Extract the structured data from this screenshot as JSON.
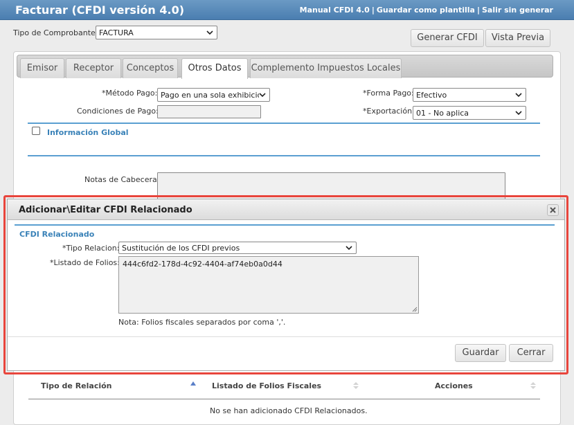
{
  "header": {
    "title": "Facturar (CFDI versión 4.0)",
    "links": [
      "Manual CFDI 4.0",
      "Guardar como plantilla",
      "Salir sin generar"
    ],
    "separator": "|"
  },
  "top": {
    "tipo_label": "Tipo de Comprobante:",
    "tipo_value": "FACTURA",
    "generar_label": "Generar CFDI",
    "vista_label": "Vista Previa"
  },
  "tabs": [
    {
      "label": "Emisor"
    },
    {
      "label": "Receptor"
    },
    {
      "label": "Conceptos"
    },
    {
      "label": "Otros Datos"
    },
    {
      "label": "Complemento Impuestos Locales"
    }
  ],
  "otros": {
    "metodo_label": "*Método Pago:",
    "metodo_value": "Pago en una sola exhibició",
    "condiciones_label": "Condiciones de Pago:",
    "forma_label": "*Forma Pago:",
    "forma_value": "Efectivo",
    "exportacion_label": "*Exportación:",
    "exportacion_value": "01 - No aplica",
    "info_global": "Información Global",
    "notas_label": "Notas de Cabecera:"
  },
  "table": {
    "headers": [
      "Tipo de Relación",
      "Listado de Folios Fiscales",
      "Acciones"
    ],
    "empty": "No se han adicionado CFDI Relacionados."
  },
  "modal": {
    "title": "Adicionar\\Editar CFDI Relacionado",
    "section": "CFDI Relacionado",
    "tipo_label": "*Tipo Relacion:",
    "tipo_value": "Sustitución de los CFDI previos",
    "folios_label": "*Listado de Folios:",
    "folios_value": "444c6fd2-178d-4c92-4404-af74eb0a0d44",
    "note": "Nota: Folios fiscales separados por coma ','.",
    "guardar": "Guardar",
    "cerrar": "Cerrar"
  },
  "colors": {
    "header": "#4a7eb0",
    "accent": "#5a9fd1",
    "highlight": "#e8453c"
  }
}
